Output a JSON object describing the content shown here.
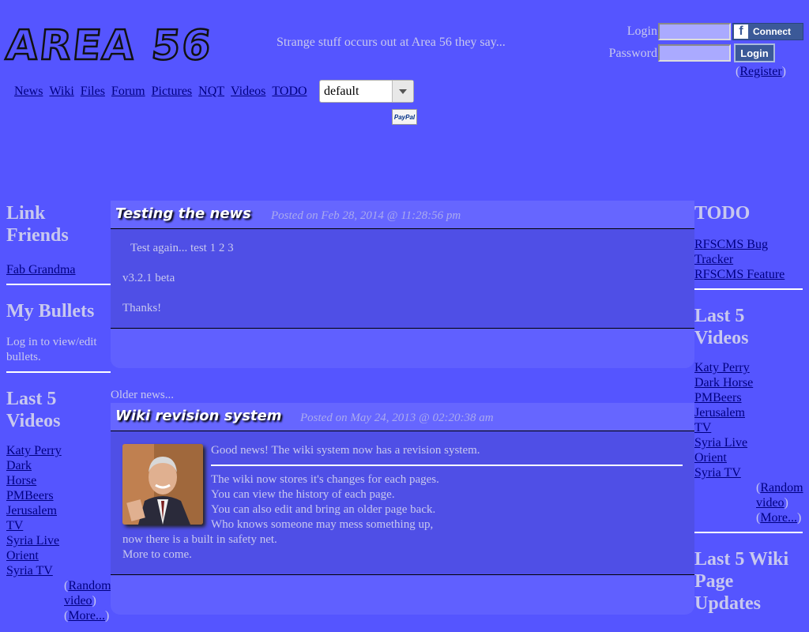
{
  "header": {
    "logo": "AREA 56",
    "tagline": "Strange stuff occurs out at Area 56 they say...",
    "login_label": "Login",
    "password_label": "Password",
    "connect_label": "Connect",
    "login_button": "Login",
    "register_open": "(",
    "register_link": "Register",
    "register_close": ")"
  },
  "nav": {
    "items": [
      "News",
      "Wiki",
      "Files",
      "Forum",
      "Pictures",
      "NQT",
      "Videos",
      "TODO"
    ],
    "theme_selected": "default",
    "paypal": "PayPal"
  },
  "left": {
    "link_friends_title": "Link Friends",
    "link_friends": [
      "Fab Grandma"
    ],
    "bullets_title": "My Bullets",
    "bullets_text": "Log in to view/edit bullets.",
    "videos_title": "Last 5 Videos",
    "videos": [
      "Katy Perry",
      "Dark Horse",
      "PMBeers",
      "Jerusalem TV",
      "Syria Live Orient",
      "Syria TV"
    ],
    "random_video": "Random video",
    "more": "More..."
  },
  "right": {
    "todo_title": "TODO",
    "todo_links": [
      "RFSCMS Bug Tracker",
      "RFSCMS Feature"
    ],
    "videos_title": "Last 5 Videos",
    "videos": [
      "Katy Perry",
      "Dark Horse",
      "PMBeers",
      "Jerusalem TV",
      "Syria Live Orient",
      "Syria TV"
    ],
    "random_video": "Random video",
    "more": "More...",
    "wiki_title": "Last 5 Wiki Page Updates"
  },
  "news": [
    {
      "title": "Testing the news",
      "date": "Posted on Feb 28, 2014 @ 11:28:56 pm",
      "lines": [
        "Test again... test 1 2 3",
        "v3.2.1 beta",
        "Thanks!"
      ]
    },
    {
      "title": "Wiki revision system",
      "date": "Posted on May 24, 2013 @ 02:20:38 am",
      "lead": "Good news! The wiki system now has a revision system.",
      "lines": [
        "The wiki now stores it's changes for each pages.",
        "You can view the history of each page.",
        "You can also edit and bring an older page back.",
        "Who knows someone may mess something up,",
        "now there is a built in safety net.",
        "More to come."
      ]
    }
  ],
  "older_news": "Older news..."
}
